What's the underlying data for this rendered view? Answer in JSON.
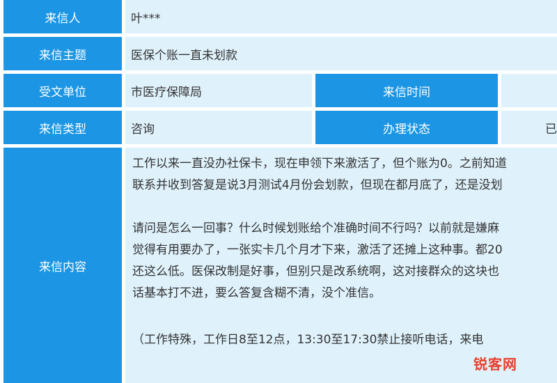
{
  "letter": {
    "sender_label": "来信人",
    "sender_value": "叶***",
    "subject_label": "来信主题",
    "subject_value": "医保个账一直未划款",
    "unit_label": "受文单位",
    "unit_value": "市医疗保障局",
    "time_label": "来信时间",
    "time_value": "",
    "type_label": "来信类型",
    "type_value": "咨询",
    "status_label": "办理状态",
    "status_value": "已",
    "content_label": "来信内容",
    "content_lines": [
      "工作以来一直没办社保卡，现在申领下来激活了，但个账为0。之前知道",
      "联系并收到答复是说3月测试4月份会划款，但现在都月底了，还是没划",
      "",
      "请问是怎么一回事？什么时候划账给个准确时间不行吗？以前就是嫌麻",
      "觉得有用要办了，一张实卡几个月才下来，激活了还摊上这种事。都20",
      "还这么低。医保改制是好事，但别只是改系统啊，这对接群众的这块也",
      "话基本打不进，要么答复含糊不清，没个准信。",
      "",
      "（工作特殊，工作日8至12点，13:30至17:30禁止接听电话，来电"
    ]
  },
  "watermark": {
    "text": "锐客网"
  }
}
